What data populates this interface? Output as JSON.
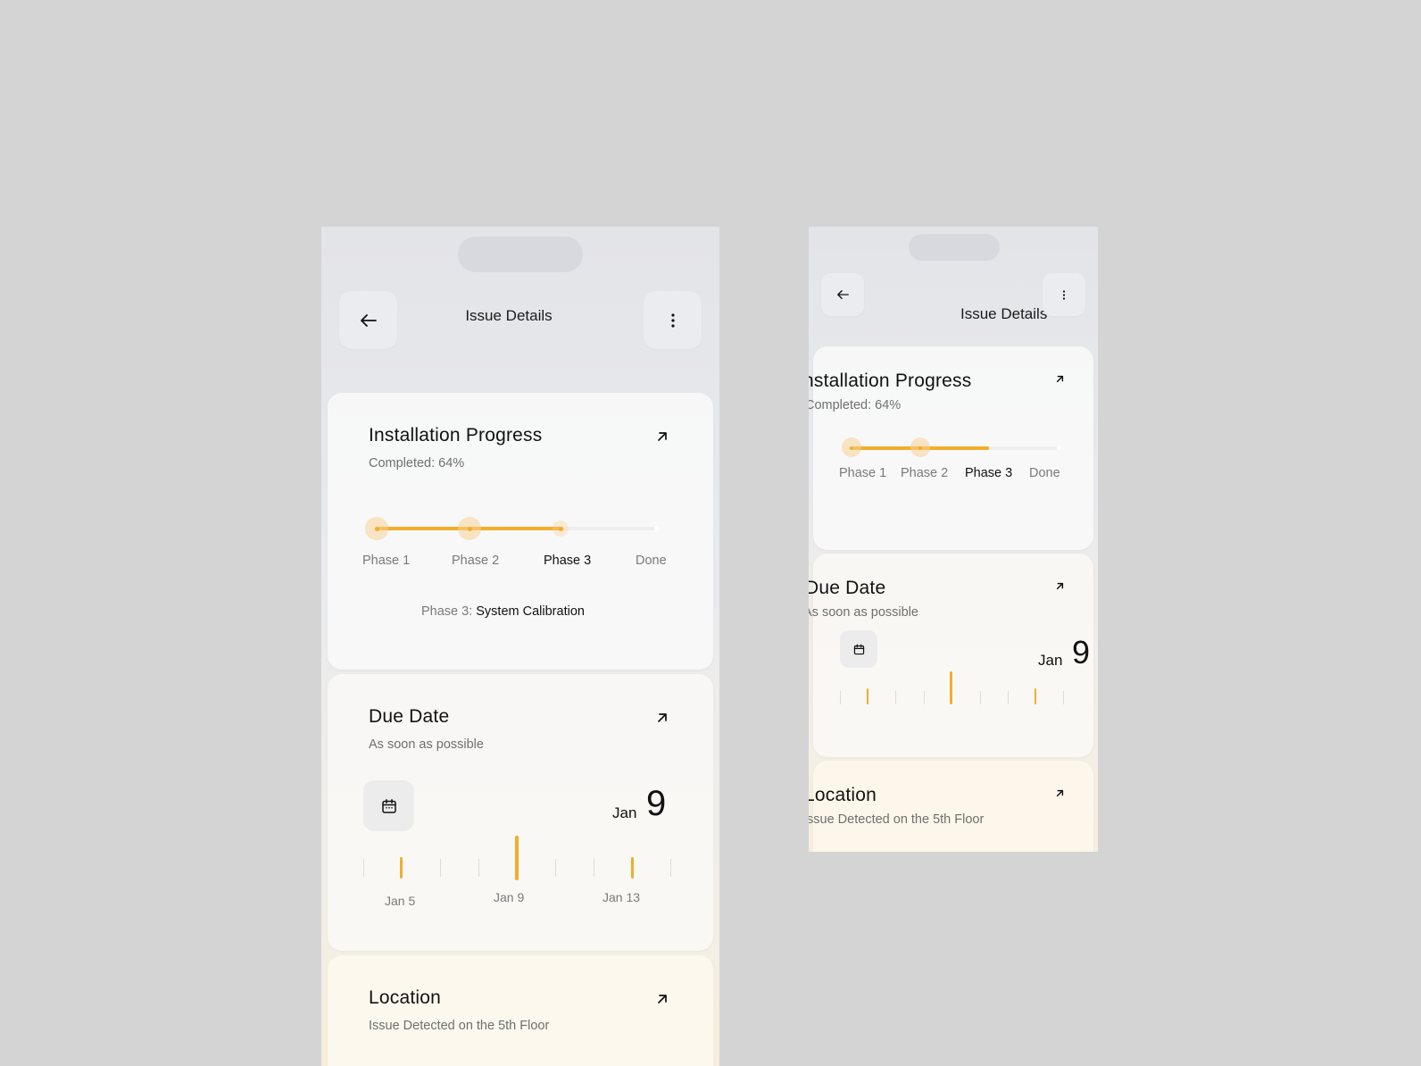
{
  "screen": {
    "title": "Issue Details"
  },
  "progress": {
    "title": "Installation Progress",
    "subtitle": "Completed: 64%",
    "percent": 64,
    "phases": [
      "Phase 1",
      "Phase 2",
      "Phase 3",
      "Done"
    ],
    "active_phase": "Phase 3",
    "current_prefix": "Phase 3: ",
    "current_name": "System Calibration",
    "accent": "#f2ad2c"
  },
  "due": {
    "title": "Due Date",
    "subtitle": "As soon as possible",
    "month": "Jan",
    "day": "9",
    "timeline_labels": [
      "Jan 5",
      "Jan 9",
      "Jan 13"
    ]
  },
  "location": {
    "title": "Location",
    "subtitle": "Issue Detected on the 5th Floor"
  },
  "icons": {
    "back": "arrow-left-icon",
    "more": "more-vertical-icon",
    "expand": "arrow-up-right-icon",
    "calendar": "calendar-icon"
  }
}
